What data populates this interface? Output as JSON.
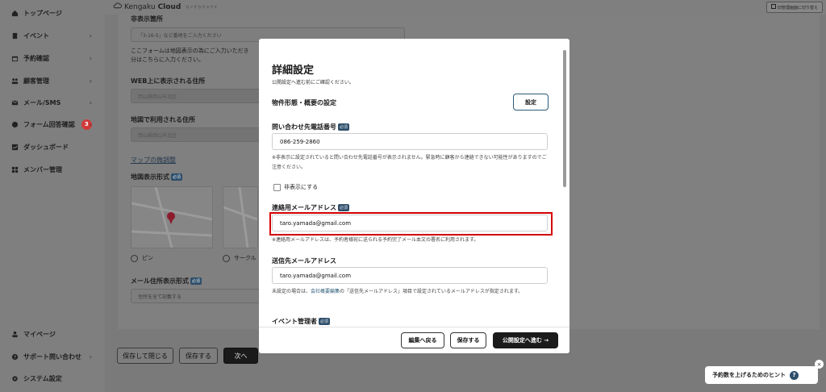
{
  "sidebar": {
    "items": [
      {
        "label": "トップページ",
        "icon": "home-icon",
        "chevron": ""
      },
      {
        "label": "イベント",
        "icon": "document-icon",
        "chevron": "›"
      },
      {
        "label": "予約確認",
        "icon": "calendar-icon",
        "chevron": "›"
      },
      {
        "label": "顧客管理",
        "icon": "users-icon",
        "chevron": "›"
      },
      {
        "label": "メール/SMS",
        "icon": "mail-icon",
        "chevron": "›"
      },
      {
        "label": "フォーム回答確認",
        "icon": "chat-icon",
        "chevron": "›",
        "badge": "3"
      },
      {
        "label": "ダッシュボード",
        "icon": "chart-icon",
        "chevron": ""
      },
      {
        "label": "メンバー管理",
        "icon": "grid-icon",
        "chevron": ""
      }
    ],
    "bottom_items": [
      {
        "label": "マイページ",
        "icon": "person-icon"
      },
      {
        "label": "サポート問い合わせ",
        "icon": "help-icon",
        "chevron": "›"
      },
      {
        "label": "システム設定",
        "icon": "gear-icon"
      }
    ]
  },
  "header": {
    "logo_light": "Kengaku",
    "logo_bold": "Cloud",
    "logo_tag": "カンゲカクラウド",
    "switch_label": "旧管理画面に切り替え"
  },
  "main": {
    "hidden_addr_label": "非表示箇所",
    "hidden_addr_placeholder": "「3-16-5」など番地をご入力ください",
    "hidden_addr_note_1": "ここフォームは地図表示の為にご入力いただき",
    "hidden_addr_note_2": "分はこちらに入力ください。",
    "web_addr_label": "WEB上に表示される住所",
    "web_addr_value": "岡山県岡山市北区",
    "map_addr_label": "地図で利用される住所",
    "map_addr_value": "岡山県岡山市北区",
    "map_adjust_link": "マップの微調整",
    "map_style_label": "地図表示形式",
    "required": "必須",
    "radio_pin": "ピン",
    "radio_circle": "サークル",
    "mail_addr_label": "メール住所表示形式",
    "mail_addr_value": "住所を全て記載する",
    "save_close_button": "保存して閉じる",
    "save_button": "保存する",
    "next_button": "次へ"
  },
  "modal": {
    "title": "詳細設定",
    "subtitle": "公開設定へ進む前にご確認ください。",
    "property_section_label": "物件形態・概要の設定",
    "settings_button": "設定",
    "phone_label": "問い合わせ先電話番号",
    "phone_value": "086-259-2860",
    "phone_note": "※非表示に設定されていると問い合わせ先電話番号が表示されません。緊急時に顧客から連絡できない可能性がありますのでご注意ください。",
    "hide_checkbox_label": "非表示にする",
    "contact_email_label": "連絡用メールアドレス",
    "contact_email_value": "taro.yamada@gmail.com",
    "contact_email_note": "※連絡用メールアドレスは、予約者様宛に送られる予約完了メール本文の署名に利用されます。",
    "dest_email_label": "送信先メールアドレス",
    "dest_email_value": "taro.yamada@gmail.com",
    "dest_note_prefix": "未設定の場合は、",
    "dest_note_link": "会社概要編集",
    "dest_note_suffix": "の「送信先メールアドレス」項目で設定されているメールアドレスが指定されます。",
    "event_manager_label": "イベント管理者",
    "required": "必須",
    "back_button": "編集へ戻る",
    "save_button": "保存する",
    "proceed_button": "公開設定へ進む →"
  },
  "hint": {
    "label": "予約数を上げるためのヒント",
    "close": "×"
  }
}
